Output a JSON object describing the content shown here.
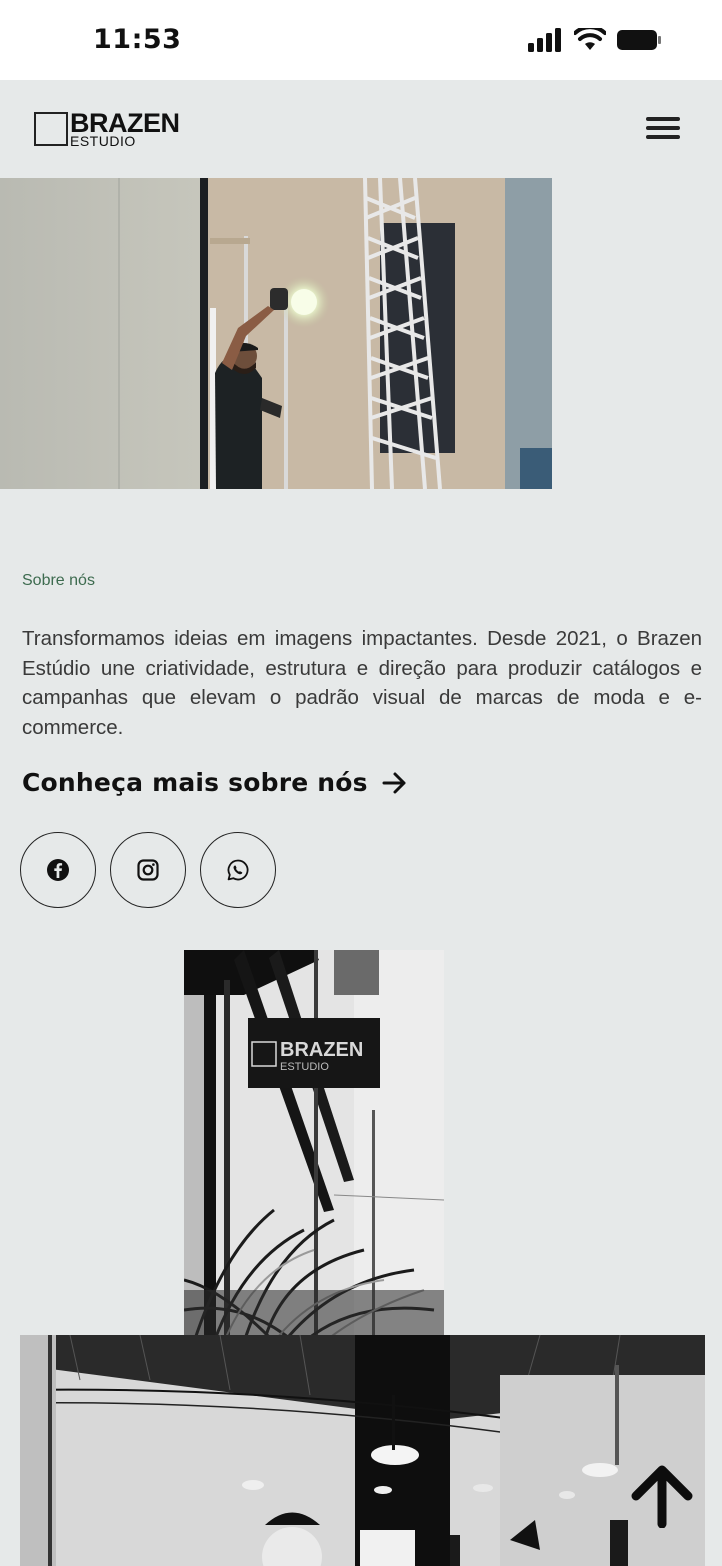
{
  "status_bar": {
    "time": "11:53",
    "icons": [
      "signal-icon",
      "wifi-icon",
      "battery-icon"
    ]
  },
  "header": {
    "logo": {
      "name": "BRAZEN",
      "sub": "ESTUDIO"
    },
    "menu_icon": "hamburger-menu-icon"
  },
  "about": {
    "label": "Sobre nós",
    "text": "Transformamos ideias em imagens impactantes. Desde 2021, o Brazen Estúdio une criatividade, estrutura e direção para produzir catálogos e campanhas que elevam o padrão visual de marcas de moda e e-commerce.",
    "link_label": "Conheça mais sobre nós",
    "link_icon": "arrow-right-icon"
  },
  "socials": [
    {
      "name": "facebook",
      "icon": "facebook-icon"
    },
    {
      "name": "instagram",
      "icon": "instagram-icon"
    },
    {
      "name": "whatsapp",
      "icon": "whatsapp-icon"
    }
  ],
  "sign_photo": {
    "brand": "BRAZEN",
    "sub": "ESTUDIO"
  },
  "back_to_top_icon": "arrow-up-icon",
  "colors": {
    "background": "#e6e9e9",
    "label_green": "#3d6b4f",
    "text": "#3a3a3a"
  }
}
